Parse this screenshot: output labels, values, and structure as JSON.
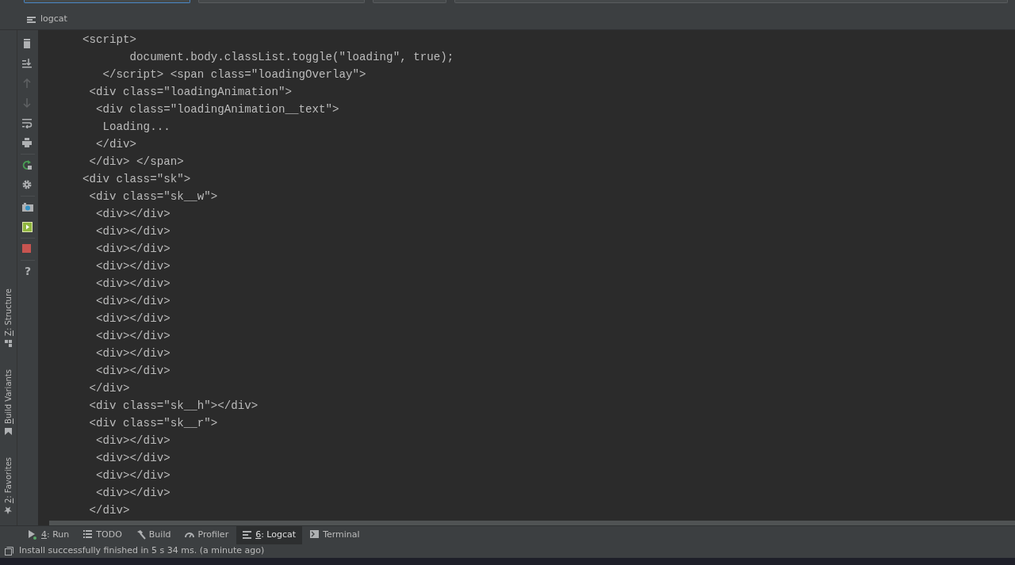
{
  "top_fields": [
    {
      "focused": true
    },
    {
      "focused": false
    },
    {
      "focused": false
    },
    {
      "focused": false
    }
  ],
  "panel": {
    "title": "logcat"
  },
  "toolbar": [
    {
      "kind": "trash",
      "disabled": false
    },
    {
      "kind": "scroll-end",
      "disabled": false
    },
    {
      "kind": "up",
      "disabled": true
    },
    {
      "kind": "down",
      "disabled": true
    },
    {
      "kind": "wrap",
      "disabled": false
    },
    {
      "kind": "print",
      "disabled": false
    },
    {
      "kind": "restart",
      "disabled": false
    },
    {
      "kind": "gear",
      "disabled": false
    },
    {
      "kind": "camera",
      "disabled": false
    },
    {
      "kind": "record",
      "disabled": false
    },
    {
      "kind": "stop",
      "disabled": false
    },
    {
      "kind": "help",
      "glyph": "?",
      "disabled": false
    }
  ],
  "side_tabs": [
    {
      "label": "Z: Structure",
      "kind": "structure"
    },
    {
      "label": "Build Variants",
      "kind": "variants"
    },
    {
      "label": "2: Favorites",
      "kind": "favorites"
    }
  ],
  "code_lines": [
    "<script>",
    "       document.body.classList.toggle(\"loading\", true);",
    "   </script> <span class=\"loadingOverlay\">",
    " <div class=\"loadingAnimation\">",
    "  <div class=\"loadingAnimation__text\">",
    "   Loading...",
    "  </div>",
    " </div> </span>",
    "<div class=\"sk\">",
    " <div class=\"sk__w\">",
    "  <div></div>",
    "  <div></div>",
    "  <div></div>",
    "  <div></div>",
    "  <div></div>",
    "  <div></div>",
    "  <div></div>",
    "  <div></div>",
    "  <div></div>",
    "  <div></div>",
    " </div>",
    " <div class=\"sk__h\"></div>",
    " <div class=\"sk__r\">",
    "  <div></div>",
    "  <div></div>",
    "  <div></div>",
    "  <div></div>",
    " </div>"
  ],
  "bottom_tabs": [
    {
      "label": "4: Run",
      "kind": "run",
      "selected": false
    },
    {
      "label": "TODO",
      "kind": "todo",
      "selected": false
    },
    {
      "label": "Build",
      "kind": "build",
      "selected": false
    },
    {
      "label": "Profiler",
      "kind": "profiler",
      "selected": false
    },
    {
      "label": "6: Logcat",
      "kind": "logcat",
      "selected": true
    },
    {
      "label": "Terminal",
      "kind": "terminal",
      "selected": false
    }
  ],
  "status_bar": {
    "text": "Install successfully finished in 5 s 34 ms. (a minute ago)"
  }
}
